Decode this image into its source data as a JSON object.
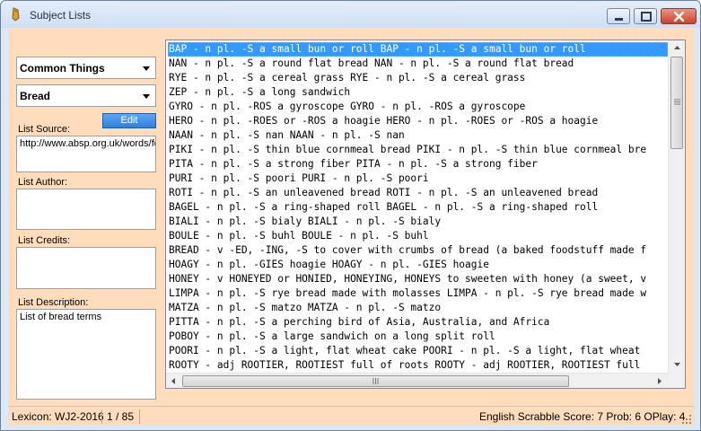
{
  "window": {
    "title": "Subject Lists",
    "controls": [
      "minimize",
      "maximize",
      "close"
    ]
  },
  "sidebar": {
    "category_select": "Common Things",
    "subject_select": "Bread",
    "list_source_label": "List Source:",
    "edit_button": "Edit",
    "list_source_value": "http://www.absp.org.uk/words/foodbread.shtml",
    "list_author_label": "List Author:",
    "list_author_value": "",
    "list_credits_label": "List Credits:",
    "list_credits_value": "",
    "list_description_label": "List Description:",
    "list_description_value": "List of bread terms"
  },
  "word_list": {
    "selected_index": 0,
    "rows": [
      "BAP - n pl. -S a small bun or roll BAP - n pl. -S a small bun or roll",
      "NAN - n pl. -S a round flat bread NAN - n pl. -S a round flat bread",
      "RYE - n pl. -S a cereal grass RYE - n pl. -S a cereal grass",
      "ZEP - n pl. -S a long sandwich",
      "GYRO - n pl. -ROS a gyroscope GYRO - n pl. -ROS a gyroscope",
      "HERO - n pl. -ROES or -ROS a hoagie HERO - n pl. -ROES or -ROS a hoagie",
      "NAAN - n pl. -S nan NAAN - n pl. -S nan",
      "PIKI - n pl. -S thin blue cornmeal bread PIKI - n pl. -S thin blue cornmeal bre",
      "PITA - n pl. -S a strong fiber PITA - n pl. -S a strong fiber",
      "PURI - n pl. -S poori PURI - n pl. -S poori",
      "ROTI - n pl. -S an unleavened bread ROTI - n pl. -S an unleavened bread",
      "BAGEL - n pl. -S a ring-shaped roll BAGEL - n pl. -S a ring-shaped roll",
      "BIALI - n pl. -S bialy BIALI - n pl. -S bialy",
      "BOULE - n pl. -S buhl BOULE - n pl. -S buhl",
      "BREAD - v -ED, -ING, -S to cover with crumbs of bread (a baked foodstuff made f",
      "HOAGY - n pl. -GIES hoagie HOAGY - n pl. -GIES hoagie",
      "HONEY - v HONEYED or HONIED, HONEYING, HONEYS to sweeten with honey (a sweet, v",
      "LIMPA - n pl. -S rye bread made with molasses LIMPA - n pl. -S rye bread made w",
      "MATZA - n pl. -S matzo MATZA - n pl. -S matzo",
      "PITTA - n pl. -S a perching bird of Asia, Australia, and Africa",
      "POBOY - n pl. -S a large sandwich on a long split roll",
      "POORI - n pl. -S a light, flat wheat cake POORI - n pl. -S a light, flat wheat",
      "ROOTY - adj ROOTIER, ROOTIEST full of roots ROOTY - adj ROOTIER, ROOTIEST full"
    ]
  },
  "statusbar": {
    "lexicon": "Lexicon: WJ2-2016",
    "position": "1 / 85",
    "score": "English Scrabble Score: 7 Prob:  6 OPlay: 4"
  },
  "colors": {
    "client_bg": "#ffdcbc",
    "selection": "#3399ff",
    "edit_button": "#3c8ce6"
  }
}
